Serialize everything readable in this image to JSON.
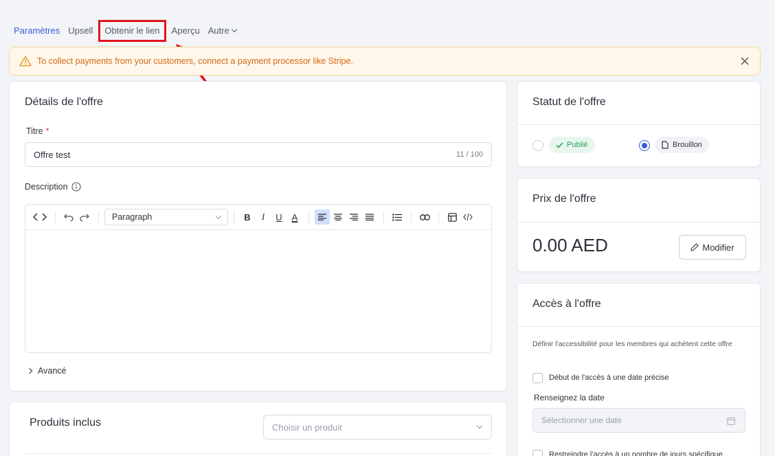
{
  "tabs": [
    {
      "label": "Paramètres"
    },
    {
      "label": "Upsell"
    },
    {
      "label": "Obtenir le lien"
    },
    {
      "label": "Aperçu"
    },
    {
      "label": "Autre"
    }
  ],
  "alert": {
    "text": "To collect payments from your customers, connect a payment processor like Stripe."
  },
  "details": {
    "title": "Détails de l'offre",
    "title_label": "Titre",
    "required_mark": "*",
    "title_value": "Offre test",
    "counter": "11 / 100",
    "description_label": "Description",
    "paragraph_select": "Paragraph",
    "toolbar": {
      "bold": "B",
      "italic": "I",
      "underline": "U",
      "color": "A"
    },
    "advanced": "Avancé"
  },
  "products": {
    "title": "Produits inclus",
    "select_placeholder": "Choisir un produit"
  },
  "status": {
    "title": "Statut de l'offre",
    "published": "Publié",
    "draft": "Brouillon",
    "selected": "draft"
  },
  "price": {
    "title": "Prix de l'offre",
    "value": "0.00 AED",
    "edit_label": "Modifier"
  },
  "access": {
    "title": "Accès à l'offre",
    "description": "Définir l'accessibilité pour les membres qui achètent cette offre",
    "start_date_label": "Début de l'accès à une date précise",
    "date_label": "Renseignez la date",
    "date_placeholder": "Sélectionner une date",
    "restrict_label": "Restreindre l'accès à un nombre de jours spécifique"
  },
  "colors": {
    "accent": "#3b5bdb",
    "highlight": "#e3141c",
    "warning": "#d2691a"
  }
}
